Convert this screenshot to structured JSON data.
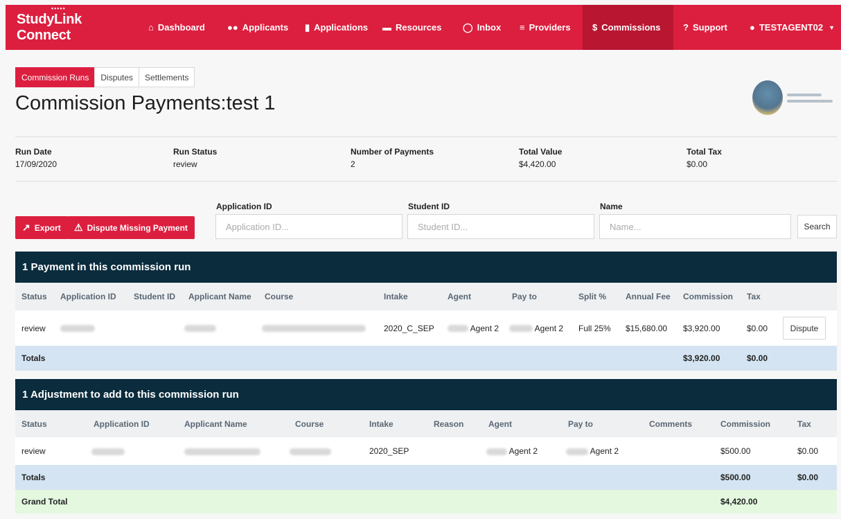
{
  "brand": {
    "name": "StudyLink Connect",
    "logo_dots": "•••••"
  },
  "nav": {
    "items": [
      {
        "label": "Dashboard"
      },
      {
        "label": "Applicants"
      },
      {
        "label": "Applications"
      },
      {
        "label": "Resources"
      },
      {
        "label": "Inbox"
      },
      {
        "label": "Providers"
      },
      {
        "label": "Commissions"
      },
      {
        "label": "Support"
      },
      {
        "label": "TESTAGENT02"
      }
    ],
    "active": "Commissions"
  },
  "tabs": [
    {
      "label": "Commission Runs",
      "active": true
    },
    {
      "label": "Disputes",
      "active": false
    },
    {
      "label": "Settlements",
      "active": false
    }
  ],
  "page": {
    "title": "Commission Payments:test 1"
  },
  "summary": {
    "run_date": {
      "label": "Run Date",
      "value": "17/09/2020"
    },
    "run_status": {
      "label": "Run Status",
      "value": "review"
    },
    "num_payments": {
      "label": "Number of Payments",
      "value": "2"
    },
    "total_value": {
      "label": "Total Value",
      "value": "$4,420.00"
    },
    "total_tax": {
      "label": "Total Tax",
      "value": "$0.00"
    }
  },
  "actions": {
    "export": "Export",
    "dispute_missing": "Dispute Missing Payment",
    "search": "Search"
  },
  "filters": {
    "application_id": {
      "label": "Application ID",
      "placeholder": "Application ID..."
    },
    "student_id": {
      "label": "Student ID",
      "placeholder": "Student ID..."
    },
    "name": {
      "label": "Name",
      "placeholder": "Name..."
    }
  },
  "payments": {
    "title": "1 Payment in this commission run",
    "headers": [
      "Status",
      "Application ID",
      "Student ID",
      "Applicant Name",
      "Course",
      "Intake",
      "Agent",
      "Pay to",
      "Split %",
      "Annual Fee",
      "Commission",
      "Tax"
    ],
    "rows": [
      {
        "status": "review",
        "intake": "2020_C_SEP",
        "agent": "Agent 2",
        "pay_to": "Agent 2",
        "split": "Full 25%",
        "annual_fee": "$15,680.00",
        "commission": "$3,920.00",
        "tax": "$0.00",
        "action": "Dispute"
      }
    ],
    "totals": {
      "label": "Totals",
      "commission": "$3,920.00",
      "tax": "$0.00"
    }
  },
  "adjustments": {
    "title": "1 Adjustment to add to this commission run",
    "headers": [
      "Status",
      "Application ID",
      "Applicant Name",
      "Course",
      "Intake",
      "Reason",
      "Agent",
      "Pay to",
      "Comments",
      "Commission",
      "Tax"
    ],
    "rows": [
      {
        "status": "review",
        "intake": "2020_SEP",
        "agent": "Agent 2",
        "pay_to": "Agent 2",
        "commission": "$500.00",
        "tax": "$0.00"
      }
    ],
    "totals": {
      "label": "Totals",
      "commission": "$500.00",
      "tax": "$0.00"
    },
    "grand_total": {
      "label": "Grand Total",
      "commission": "$4,420.00"
    }
  },
  "colors": {
    "brand_red": "#dc1f3f",
    "active_nav": "#b81631",
    "panel_navy": "#0b2c3d",
    "totals_blue": "#d4e4f2",
    "grand_green": "#e4f8e0"
  }
}
